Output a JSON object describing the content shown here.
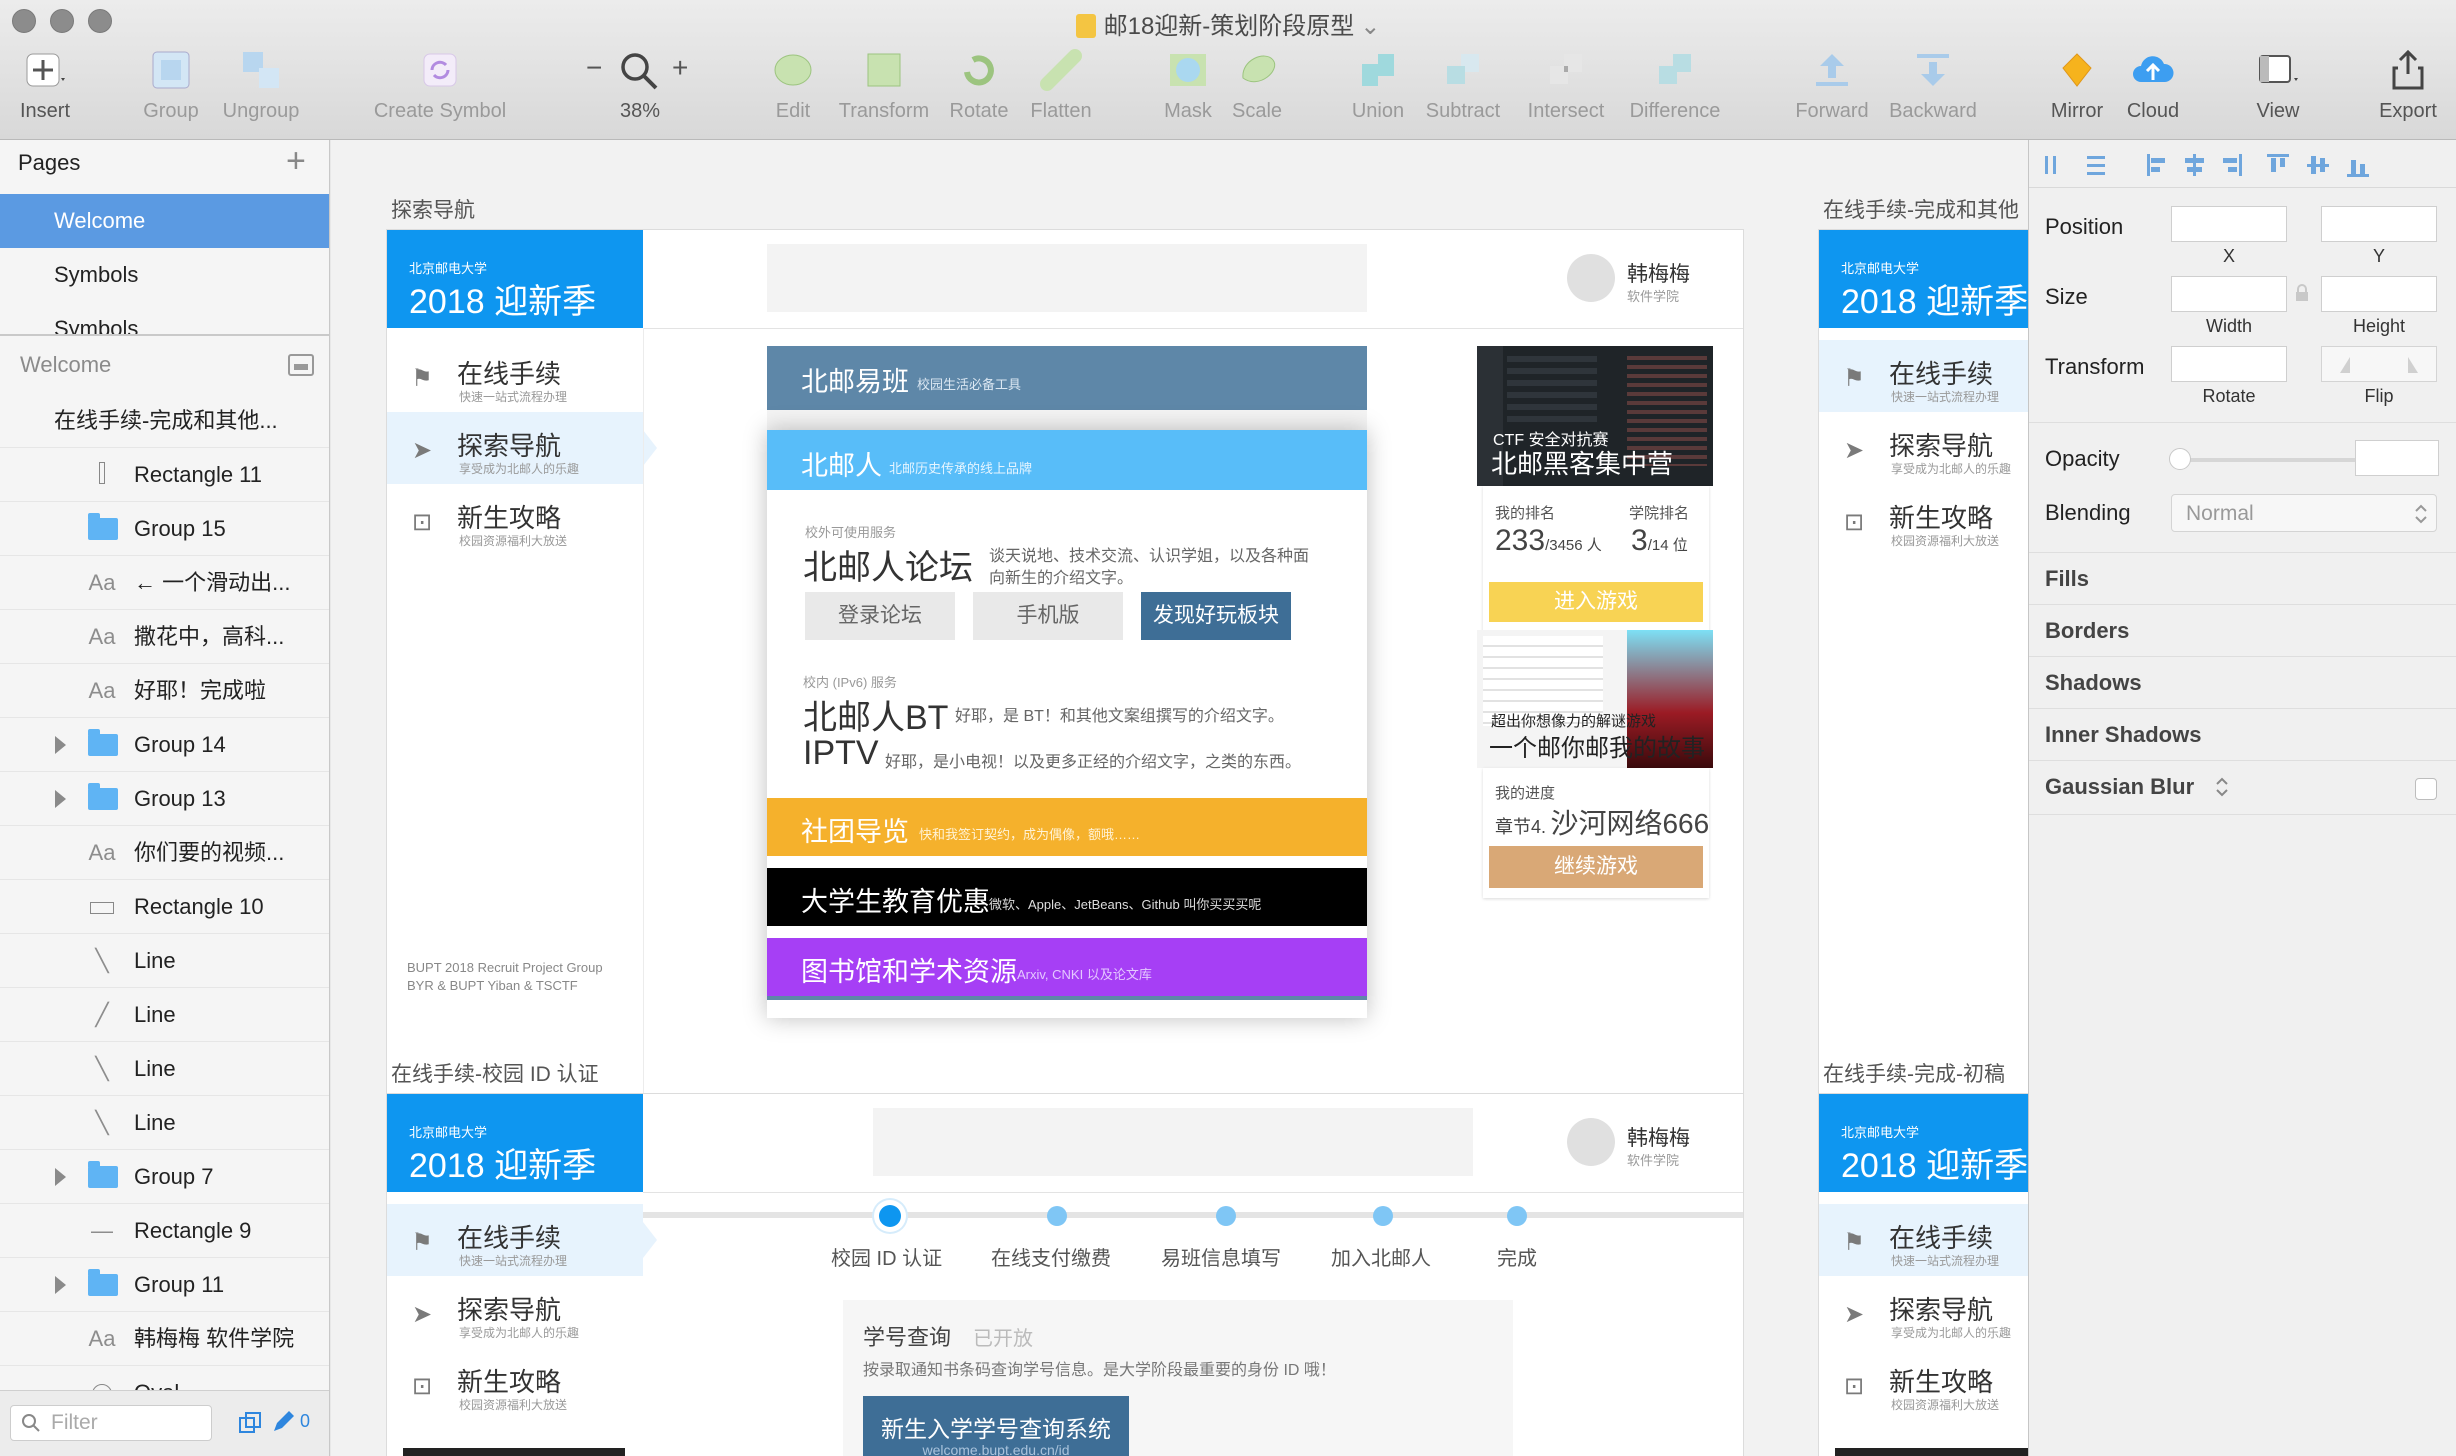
{
  "window": {
    "title": "邮18迎新-策划阶段原型"
  },
  "toolbar": {
    "insert": "Insert",
    "group": "Group",
    "ungroup": "Ungroup",
    "create_symbol": "Create Symbol",
    "zoom_minus": "−",
    "zoom_plus": "+",
    "zoom_level": "38%",
    "edit": "Edit",
    "transform": "Transform",
    "rotate": "Rotate",
    "flatten": "Flatten",
    "mask": "Mask",
    "scale": "Scale",
    "union": "Union",
    "subtract": "Subtract",
    "intersect": "Intersect",
    "difference": "Difference",
    "forward": "Forward",
    "backward": "Backward",
    "mirror": "Mirror",
    "cloud": "Cloud",
    "view": "View",
    "export": "Export"
  },
  "sidebar": {
    "pages_label": "Pages",
    "pages": [
      "Welcome",
      "Symbols",
      "Symbols"
    ],
    "layers_header": "Welcome",
    "layers": [
      {
        "type": "artboard",
        "name": "在线手续-完成和其他..."
      },
      {
        "type": "rect-v",
        "name": "Rectangle 11"
      },
      {
        "type": "folder",
        "name": "Group 15"
      },
      {
        "type": "text",
        "name": "← 一个滑动出..."
      },
      {
        "type": "text",
        "name": "撒花中，高科..."
      },
      {
        "type": "text",
        "name": "好耶！完成啦"
      },
      {
        "type": "folder-collapsed",
        "name": "Group 14"
      },
      {
        "type": "folder-collapsed",
        "name": "Group 13"
      },
      {
        "type": "text",
        "name": "你们要的视频..."
      },
      {
        "type": "rect",
        "name": "Rectangle 10"
      },
      {
        "type": "line-b",
        "name": "Line"
      },
      {
        "type": "line-f",
        "name": "Line"
      },
      {
        "type": "line-b",
        "name": "Line"
      },
      {
        "type": "line-b",
        "name": "Line"
      },
      {
        "type": "folder-collapsed",
        "name": "Group 7"
      },
      {
        "type": "line-h",
        "name": "Rectangle 9"
      },
      {
        "type": "folder-collapsed",
        "name": "Group 11"
      },
      {
        "type": "text",
        "name": "韩梅梅 软件学院"
      },
      {
        "type": "oval",
        "name": "Oval"
      }
    ],
    "text_glyph": "Aa",
    "filter_placeholder": "Filter",
    "edit_count": "0"
  },
  "artboards": {
    "explore": {
      "title": "探索导航",
      "header_small": "北京邮电大学",
      "header_big": "2018 迎新季",
      "nav": [
        {
          "title": "在线手续",
          "sub": "快速一站式流程办理"
        },
        {
          "title": "探索导航",
          "sub": "享受成为北邮人的乐趣"
        },
        {
          "title": "新生攻略",
          "sub": "校园资源福利大放送"
        }
      ],
      "footer_1": "BUPT 2018 Recruit Project Group",
      "footer_2": "BYR & BUPT Yiban & TSCTF",
      "user_name": "韩梅梅",
      "user_dept": "软件学院",
      "yiban_title": "北邮易班",
      "yiban_desc": "校园生活必备工具",
      "byr_title": "北邮人",
      "byr_desc": "北邮历史传承的线上品牌",
      "forum_tag": "校外可使用服务",
      "forum_title": "北邮人论坛",
      "forum_desc_1": "谈天说地、技术交流、认识学姐，以及各种面",
      "forum_desc_2": "向新生的介绍文字。",
      "btn_login": "登录论坛",
      "btn_mobile": "手机版",
      "btn_discover": "发现好玩板块",
      "bt_tag": "校内 (IPv6) 服务",
      "bt_title": "北邮人BT",
      "bt_desc": "好耶，是 BT！和其他文案组撰写的介绍文字。",
      "iptv_title": "IPTV",
      "iptv_desc": "好耶，是小电视！以及更多正经的介绍文字，之类的东西。",
      "clubs_title": "社团导览",
      "clubs_desc": "快和我签订契约，成为偶像，额哦……",
      "edu_title": "大学生教育优惠",
      "edu_desc": "微软、Apple、JetBeans、Github 叫你买买买呢",
      "lib_title": "图书馆和学术资源",
      "lib_desc": "Arxiv, CNKI 以及论文库",
      "ctf_overlay_1": "CTF 安全对抗赛",
      "ctf_overlay_2": "北邮黑客集中营",
      "rank_label": "我的排名",
      "rank_value": "233",
      "rank_total": "/3456 人",
      "school_rank_label": "学院排名",
      "school_rank_value": "3",
      "school_rank_total": "/14 位",
      "play_btn": "进入游戏",
      "game_overlay_1": "超出你想像力的解谜游戏",
      "game_overlay_2": "一个邮你邮我的故事",
      "progress_label": "我的进度",
      "progress_chapter": "章节4.",
      "progress_title": "沙河网络666",
      "continue_btn": "继续游戏"
    },
    "auth": {
      "title": "在线手续-校园 ID 认证",
      "header_small": "北京邮电大学",
      "header_big": "2018 迎新季",
      "nav": [
        {
          "title": "在线手续",
          "sub": "快速一站式流程办理"
        },
        {
          "title": "探索导航",
          "sub": "享受成为北邮人的乐趣"
        },
        {
          "title": "新生攻略",
          "sub": "校园资源福利大放送"
        }
      ],
      "user_name": "韩梅梅",
      "user_dept": "软件学院",
      "steps": [
        "校园 ID 认证",
        "在线支付缴费",
        "易班信息填写",
        "加入北邮人",
        "完成"
      ],
      "query_title": "学号查询",
      "query_status": "已开放",
      "query_desc": "按录取通知书条码查询学号信息。是大学阶段最重要的身份 ID 哦！",
      "query_btn": "新生入学学号查询系统",
      "query_url": "welcome.bupt.edu.cn/id"
    },
    "done_other": {
      "title": "在线手续-完成和其他",
      "header_small": "北京邮电大学",
      "header_big": "2018 迎新季",
      "nav": [
        {
          "title": "在线手续",
          "sub": "快速一站式流程办理"
        },
        {
          "title": "探索导航",
          "sub": "享受成为北邮人的乐趣"
        },
        {
          "title": "新生攻略",
          "sub": "校园资源福利大放送"
        }
      ]
    },
    "done_draft": {
      "title": "在线手续-完成-初稿",
      "header_small": "北京邮电大学",
      "header_big": "2018 迎新季",
      "nav": [
        {
          "title": "在线手续",
          "sub": "快速一站式流程办理"
        },
        {
          "title": "探索导航",
          "sub": "享受成为北邮人的乐趣"
        },
        {
          "title": "新生攻略",
          "sub": "校园资源福利大放送"
        }
      ]
    }
  },
  "inspector": {
    "position": "Position",
    "x": "X",
    "y": "Y",
    "size": "Size",
    "width": "Width",
    "height": "Height",
    "transform": "Transform",
    "rotate": "Rotate",
    "flip": "Flip",
    "opacity": "Opacity",
    "blending": "Blending",
    "blend_mode": "Normal",
    "fills": "Fills",
    "borders": "Borders",
    "shadows": "Shadows",
    "inner_shadows": "Inner Shadows",
    "gaussian_blur": "Gaussian Blur"
  },
  "colors": {
    "brand_blue": "#0e96f0",
    "selection_blue": "#5b9ae2",
    "yiban": "#5e87a8",
    "byr": "#58bdf9",
    "clubs": "#f5b12c",
    "edu": "#000000",
    "library": "#a63ff5",
    "game_yellow": "#f8d354",
    "game_tan": "#d9a876"
  }
}
